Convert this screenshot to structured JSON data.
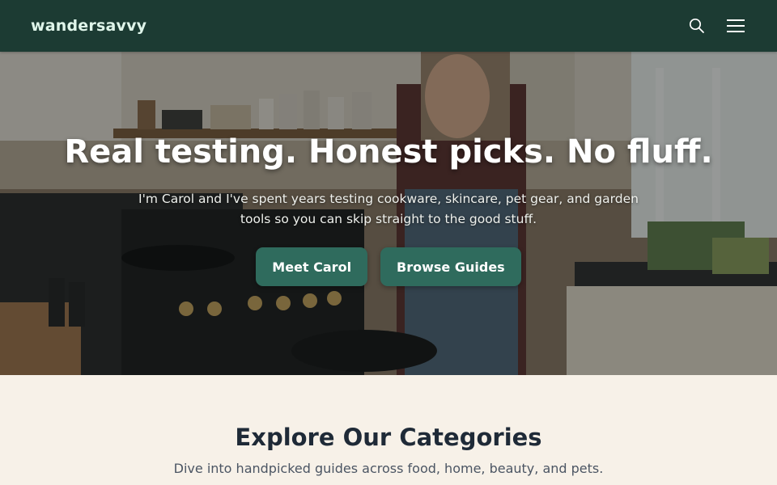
{
  "navbar": {
    "brand": "wandersavvy",
    "icons": [
      "search-icon",
      "menu-icon"
    ]
  },
  "hero": {
    "title": "Real testing. Honest picks. No fluff.",
    "subtitle": "I'm Carol and I've spent years testing cookware, skincare, pet gear, and garden tools so you can skip straight to the good stuff.",
    "buttons": {
      "primary": "Meet Carol",
      "secondary": "Browse Guides"
    },
    "image_description": ""
  },
  "categories": {
    "title": "Explore Our Categories",
    "subtitle": "Dive into handpicked guides across food, home, beauty, and pets."
  },
  "colors": {
    "navbar_bg": "#1c3b33",
    "brand_text": "#dff5ea",
    "button_bg": "#2f6b5d",
    "section_bg": "#f7f1e8",
    "heading_text": "#1f2a37"
  }
}
